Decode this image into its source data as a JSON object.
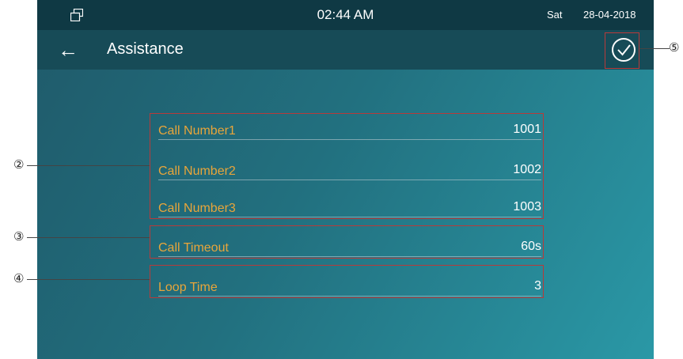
{
  "status_bar": {
    "time": "02:44 AM",
    "day": "Sat",
    "date": "28-04-2018",
    "window_icon": "window-restore-icon"
  },
  "header": {
    "back_icon": "←",
    "title": "Assistance",
    "confirm_icon": "check-circle-icon"
  },
  "fields": [
    {
      "label": "Call Number1",
      "value": "1001"
    },
    {
      "label": "Call Number2",
      "value": "1002"
    },
    {
      "label": "Call Number3",
      "value": "1003"
    },
    {
      "label": "Call Timeout",
      "value": "60s"
    },
    {
      "label": "Loop Time",
      "value": "3"
    }
  ],
  "annotations": {
    "call_numbers": "②",
    "call_timeout": "③",
    "loop_time": "④",
    "confirm": "⑤"
  },
  "colors": {
    "label": "#e8a53a",
    "status_bar": "#0f3944",
    "title_bar": "#174b57",
    "annotation_box": "#b83a3a"
  }
}
